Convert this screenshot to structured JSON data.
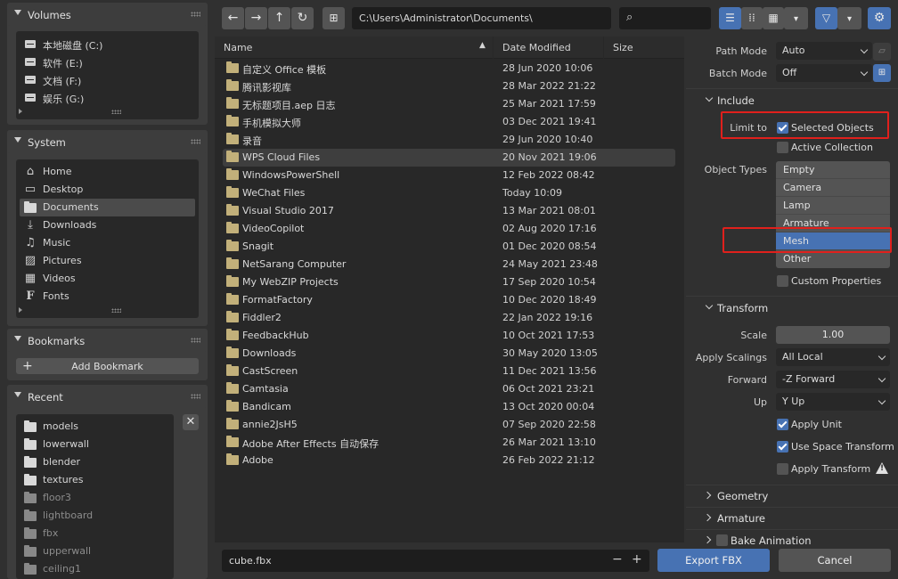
{
  "sidebar": {
    "volumes": {
      "title": "Volumes",
      "items": [
        {
          "label": "本地磁盘 (C:)",
          "icon": "drive-icon"
        },
        {
          "label": "软件 (E:)",
          "icon": "drive-icon"
        },
        {
          "label": "文档 (F:)",
          "icon": "drive-icon"
        },
        {
          "label": "娱乐 (G:)",
          "icon": "drive-icon"
        }
      ]
    },
    "system": {
      "title": "System",
      "items": [
        {
          "label": "Home",
          "icon": "home-icon"
        },
        {
          "label": "Desktop",
          "icon": "desktop-icon"
        },
        {
          "label": "Documents",
          "icon": "documents-icon"
        },
        {
          "label": "Downloads",
          "icon": "downloads-icon"
        },
        {
          "label": "Music",
          "icon": "music-icon"
        },
        {
          "label": "Pictures",
          "icon": "pictures-icon"
        },
        {
          "label": "Videos",
          "icon": "videos-icon"
        },
        {
          "label": "Fonts",
          "icon": "fonts-icon"
        }
      ]
    },
    "bookmarks": {
      "title": "Bookmarks",
      "add_label": "Add Bookmark"
    },
    "recent": {
      "title": "Recent",
      "items": [
        {
          "label": "models"
        },
        {
          "label": "lowerwall"
        },
        {
          "label": "blender"
        },
        {
          "label": "textures"
        },
        {
          "label": "floor3"
        },
        {
          "label": "lightboard"
        },
        {
          "label": "fbx"
        },
        {
          "label": "upperwall"
        },
        {
          "label": "ceiling1"
        }
      ]
    }
  },
  "toolbar": {
    "path": "C:\\Users\\Administrator\\Documents\\",
    "search_placeholder": ""
  },
  "filelist": {
    "col_name": "Name",
    "col_date": "Date Modified",
    "col_size": "Size",
    "rows": [
      {
        "name": "自定义 Office 模板",
        "date": "28 Jun 2020 10:06"
      },
      {
        "name": "腾讯影视库",
        "date": "28 Mar 2022 21:22"
      },
      {
        "name": "无标题项目.aep 日志",
        "date": "25 Mar 2021 17:59"
      },
      {
        "name": "手机模拟大师",
        "date": "03 Dec 2021 19:41"
      },
      {
        "name": "录音",
        "date": "29 Jun 2020 10:40"
      },
      {
        "name": "WPS Cloud Files",
        "date": "20 Nov 2021 19:06"
      },
      {
        "name": "WindowsPowerShell",
        "date": "12 Feb 2022 08:42"
      },
      {
        "name": "WeChat Files",
        "date": "Today 10:09"
      },
      {
        "name": "Visual Studio 2017",
        "date": "13 Mar 2021 08:01"
      },
      {
        "name": "VideoCopilot",
        "date": "02 Aug 2020 17:16"
      },
      {
        "name": "Snagit",
        "date": "01 Dec 2020 08:54"
      },
      {
        "name": "NetSarang Computer",
        "date": "24 May 2021 23:48"
      },
      {
        "name": "My WebZIP Projects",
        "date": "17 Sep 2020 10:54"
      },
      {
        "name": "FormatFactory",
        "date": "10 Dec 2020 18:49"
      },
      {
        "name": "Fiddler2",
        "date": "22 Jan 2022 19:16"
      },
      {
        "name": "FeedbackHub",
        "date": "10 Oct 2021 17:53"
      },
      {
        "name": "Downloads",
        "date": "30 May 2020 13:05"
      },
      {
        "name": "CastScreen",
        "date": "11 Dec 2021 13:56"
      },
      {
        "name": "Camtasia",
        "date": "06 Oct 2021 23:21"
      },
      {
        "name": "Bandicam",
        "date": "13 Oct 2020 00:04"
      },
      {
        "name": "annie2JsH5",
        "date": "07 Sep 2020 22:58"
      },
      {
        "name": "Adobe After Effects 自动保存",
        "date": "26 Mar 2021 13:10"
      },
      {
        "name": "Adobe",
        "date": "26 Feb 2022 21:12"
      }
    ]
  },
  "bottom": {
    "filename": "cube.fbx",
    "minus": "−",
    "plus": "+",
    "export_label": "Export FBX",
    "cancel_label": "Cancel"
  },
  "settings": {
    "path_mode_label": "Path Mode",
    "path_mode_value": "Auto",
    "batch_mode_label": "Batch Mode",
    "batch_mode_value": "Off",
    "include_title": "Include",
    "limit_to_label": "Limit to",
    "selected_objects": "Selected Objects",
    "active_collection": "Active Collection",
    "object_types_label": "Object Types",
    "object_types": [
      "Empty",
      "Camera",
      "Lamp",
      "Armature",
      "Mesh",
      "Other"
    ],
    "custom_properties": "Custom Properties",
    "transform_title": "Transform",
    "scale_label": "Scale",
    "scale_value": "1.00",
    "apply_scalings_label": "Apply Scalings",
    "apply_scalings_value": "All Local",
    "forward_label": "Forward",
    "forward_value": "-Z Forward",
    "up_label": "Up",
    "up_value": "Y Up",
    "apply_unit": "Apply Unit",
    "use_space_transform": "Use Space Transform",
    "apply_transform": "Apply Transform",
    "geometry_title": "Geometry",
    "armature_title": "Armature",
    "bake_animation_title": "Bake Animation"
  },
  "colors": {
    "accent": "#4772b3",
    "highlight": "#e0201c",
    "folder": "#c2b07a"
  }
}
